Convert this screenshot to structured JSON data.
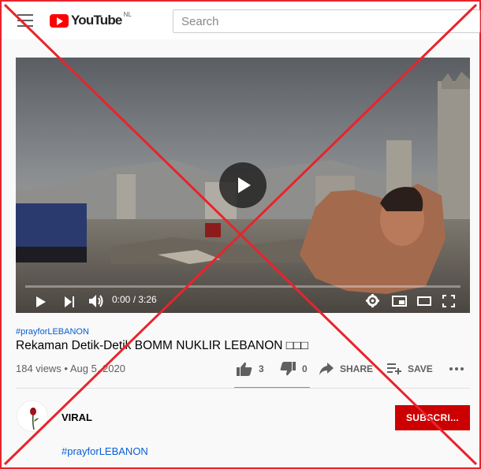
{
  "header": {
    "logo_text": "YouTube",
    "logo_region": "NL",
    "search_placeholder": "Search"
  },
  "player": {
    "time_label": "0:00 / 3:26",
    "progress": 0
  },
  "video": {
    "hashtag_top": "#prayforLEBANON",
    "title": "Rekaman Detik-Detik BOMM NUKLIR LEBANON □□□",
    "views": "184 views",
    "date": "Aug 5, 2020",
    "views_line": "184 views • Aug 5, 2020",
    "likes": "3",
    "dislikes": "0",
    "share_label": "SHARE",
    "save_label": "SAVE"
  },
  "channel": {
    "name": "VIRAL",
    "subscribe_label": "SUBSCRI...",
    "hashtag_bottom": "#prayforLEBANON"
  },
  "colors": {
    "brand_red": "#ff0000",
    "subscribe_red": "#cc0000",
    "link_blue": "#065fd4",
    "overlay_cross": "#e8242c"
  },
  "icons": [
    "menu-icon",
    "youtube-logo-icon",
    "play-icon",
    "next-icon",
    "volume-icon",
    "settings-gear-icon",
    "miniplayer-icon",
    "theater-icon",
    "fullscreen-icon",
    "thumbs-up-icon",
    "thumbs-down-icon",
    "share-icon",
    "save-playlist-icon",
    "more-icon"
  ]
}
